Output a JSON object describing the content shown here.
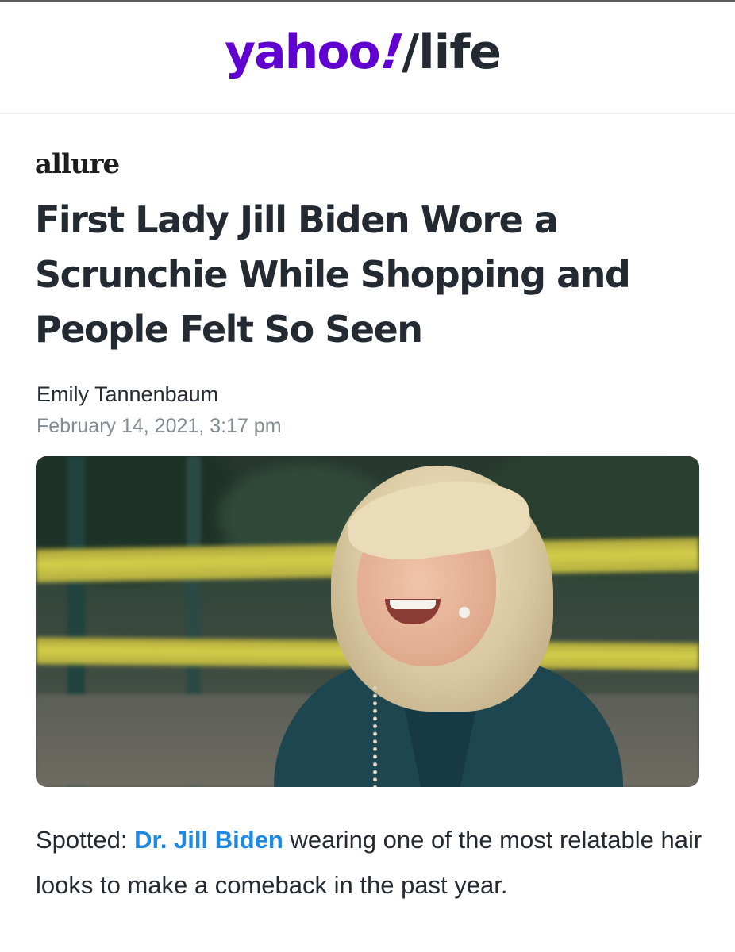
{
  "header": {
    "logo_yahoo": "yahoo",
    "logo_bang": "!",
    "logo_slash": "/",
    "logo_life": "life",
    "logo_color": "#6001d2"
  },
  "article": {
    "publisher": "allure",
    "headline": "First Lady Jill Biden Wore a Scrunchie While Shopping and People Felt So Seen",
    "author": "Emily Tannenbaum",
    "date": "February 14, 2021, 3:17 pm",
    "body": {
      "prefix": "Spotted: ",
      "link_text": "Dr. Jill Biden",
      "suffix": " wearing one of the most relatable hair looks to make a comeback in the past year."
    },
    "link_color": "#1e88e5"
  }
}
